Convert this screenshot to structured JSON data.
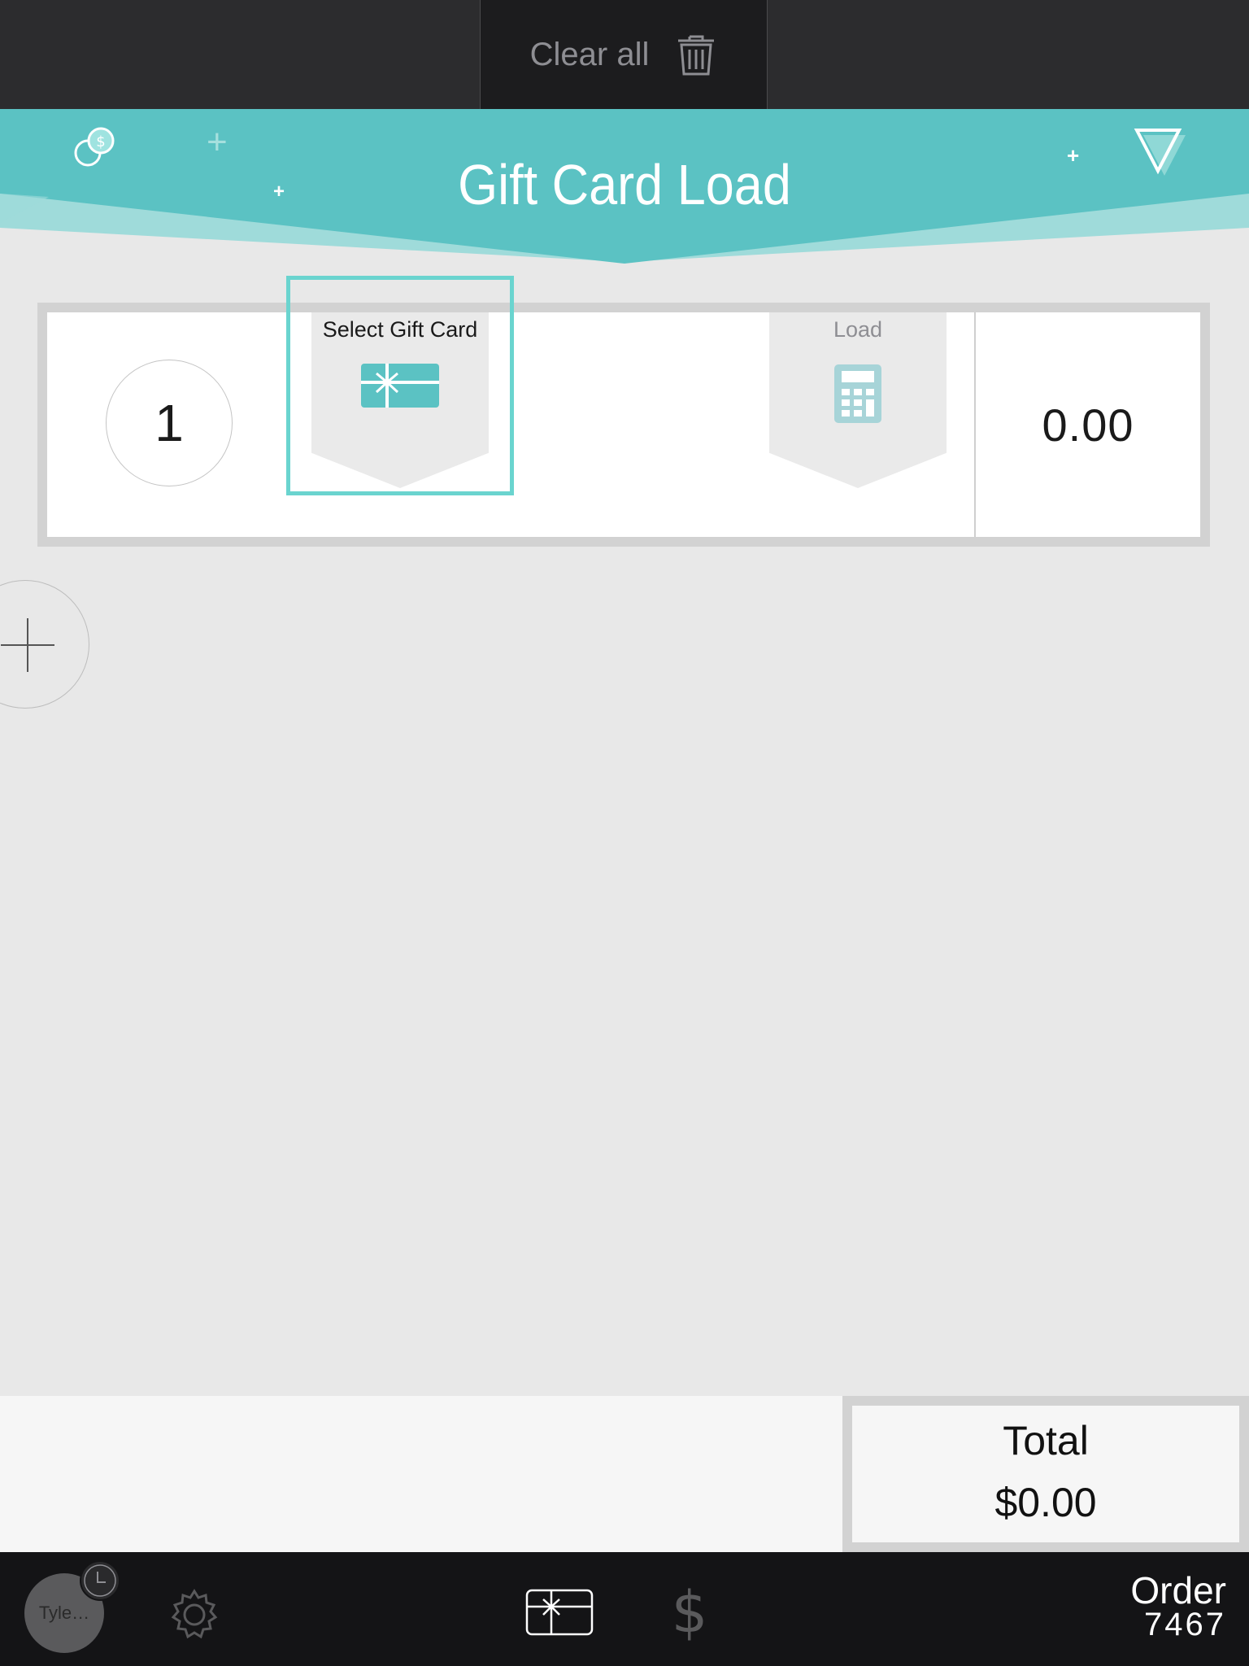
{
  "topbar": {
    "clear_all_label": "Clear all",
    "trash_icon": "trash-icon"
  },
  "header": {
    "title": "Gift Card Load",
    "accent_color": "#5bc2c3",
    "accent_light": "#9fdbda",
    "left_icon": "coin-exchange-icon",
    "right_icon": "triangle-down-icon"
  },
  "row": {
    "number": "1",
    "select_label": "Select Gift Card",
    "select_icon": "gift-card-icon",
    "load_label": "Load",
    "load_icon": "calculator-icon",
    "amount": "0.00",
    "selection_color": "#6ad4cf"
  },
  "add_row": {
    "icon": "plus-icon"
  },
  "summary": {
    "total_label": "Total",
    "total_value": "$0.00"
  },
  "bottombar": {
    "user_name": "Tyle…",
    "clock_icon": "clock-icon",
    "settings_icon": "gear-icon",
    "gift_icon": "gift-card-icon",
    "dollar_icon": "dollar-icon",
    "order_label": "Order",
    "order_number": "7467"
  }
}
